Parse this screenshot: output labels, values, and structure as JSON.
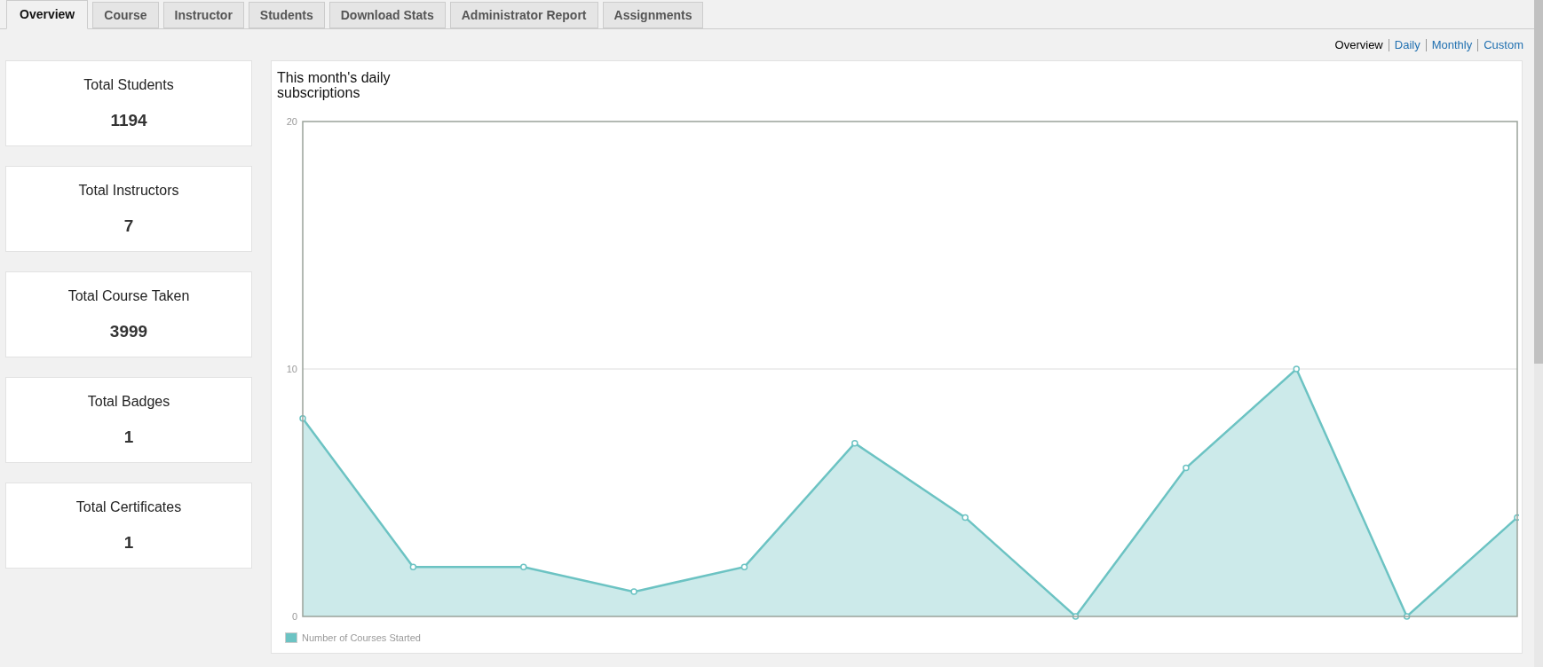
{
  "tabs": [
    {
      "label": "Overview",
      "selected": true
    },
    {
      "label": "Course",
      "selected": false
    },
    {
      "label": "Instructor",
      "selected": false
    },
    {
      "label": "Students",
      "selected": false
    },
    {
      "label": "Download Stats",
      "selected": false
    },
    {
      "label": "Administrator Report",
      "selected": false
    },
    {
      "label": "Assignments",
      "selected": false
    }
  ],
  "view_links": [
    {
      "label": "Overview",
      "selected": true
    },
    {
      "label": "Daily",
      "selected": false
    },
    {
      "label": "Monthly",
      "selected": false
    },
    {
      "label": "Custom",
      "selected": false
    }
  ],
  "stat_cards": [
    {
      "label": "Total Students",
      "value": "1194"
    },
    {
      "label": "Total Instructors",
      "value": "7"
    },
    {
      "label": "Total Course Taken",
      "value": "3999"
    },
    {
      "label": "Total Badges",
      "value": "1"
    },
    {
      "label": "Total Certificates",
      "value": "1"
    }
  ],
  "chart": {
    "chart_data": {
      "type": "area",
      "title": "This month's daily subscriptions",
      "ylim": [
        0,
        20
      ],
      "yticks": [
        0,
        10,
        20
      ],
      "series": [
        {
          "name": "Number of Courses Started",
          "color": "#6cc3c3",
          "values": [
            8,
            2,
            2,
            1,
            2,
            7,
            4,
            0,
            6,
            10,
            0,
            4
          ]
        }
      ]
    }
  }
}
